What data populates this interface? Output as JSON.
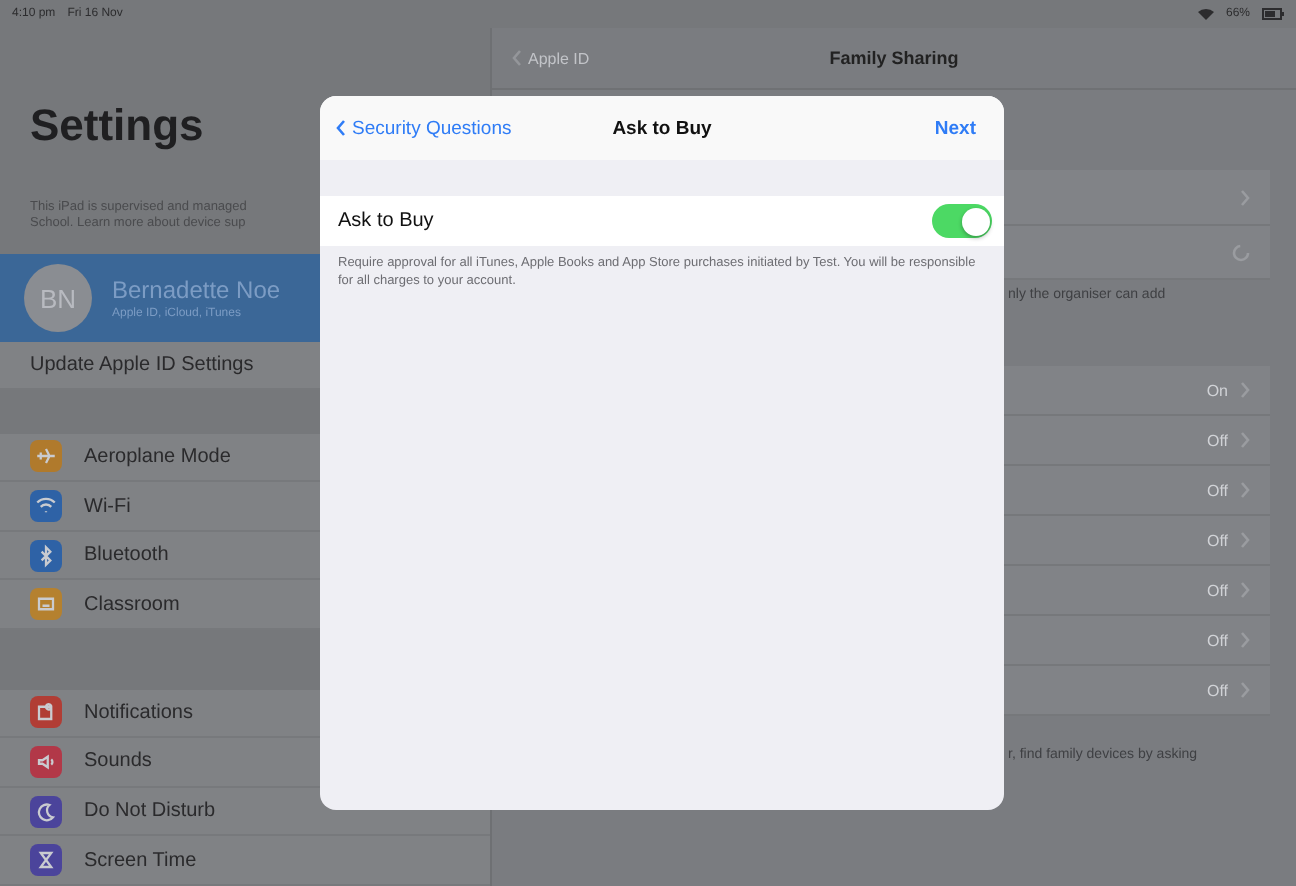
{
  "status_bar": {
    "time": "4:10 pm",
    "date": "Fri 16 Nov",
    "battery": "66%"
  },
  "sidebar": {
    "title": "Settings",
    "notice": [
      "This iPad is supervised and managed",
      "School. Learn more about device sup"
    ],
    "profile": {
      "initials": "BN",
      "name": "Bernadette Noe",
      "subtitle": "Apple ID, iCloud, iTunes"
    },
    "update_row": "Update Apple ID Settings",
    "groups": [
      [
        {
          "label": "Aeroplane Mode",
          "kind": "plane"
        },
        {
          "label": "Wi-Fi",
          "kind": "wifi"
        },
        {
          "label": "Bluetooth",
          "kind": "bluetooth"
        },
        {
          "label": "Classroom",
          "kind": "classroom"
        }
      ],
      [
        {
          "label": "Notifications",
          "kind": "notifications"
        },
        {
          "label": "Sounds",
          "kind": "sounds"
        },
        {
          "label": "Do Not Disturb",
          "kind": "moon"
        },
        {
          "label": "Screen Time",
          "kind": "hourglass"
        }
      ]
    ]
  },
  "detail": {
    "back": "Apple ID",
    "title": "Family Sharing",
    "footer_1": "nly the organiser can add",
    "rows": [
      {
        "value": "On"
      },
      {
        "value": "Off"
      },
      {
        "value": "Off"
      },
      {
        "value": "Off"
      },
      {
        "value": "Off"
      },
      {
        "value": "Off"
      },
      {
        "value": "Off"
      }
    ],
    "footer_2": "r, find family devices by asking"
  },
  "modal": {
    "back": "Security Questions",
    "title": "Ask to Buy",
    "action": "Next",
    "toggle": {
      "label": "Ask to Buy",
      "on": true
    },
    "description": "Require approval for all iTunes, Apple Books and App Store purchases initiated by Test. You will be responsible for all charges to your account."
  }
}
